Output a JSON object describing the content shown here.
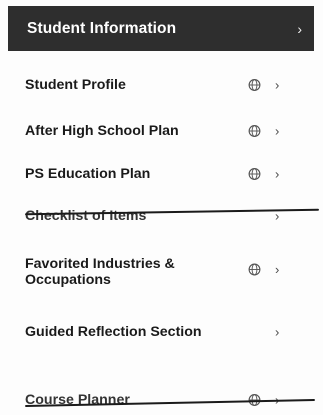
{
  "menu": {
    "header": {
      "title": "Student Information",
      "chevron": "›"
    },
    "items": [
      {
        "label": "Student Profile",
        "icon": "globe-icon",
        "chevron": "›",
        "struck": false
      },
      {
        "label": "After High School Plan",
        "icon": "globe-icon",
        "chevron": "›",
        "struck": false
      },
      {
        "label": "PS Education Plan",
        "icon": "globe-icon",
        "chevron": "›",
        "struck": false
      },
      {
        "label": "Checklist of Items",
        "icon": "",
        "chevron": "›",
        "struck": true
      },
      {
        "label": "Favorited Industries & Occupations",
        "icon": "globe-icon",
        "chevron": "›",
        "struck": false
      },
      {
        "label": "Guided Reflection Section",
        "icon": "",
        "chevron": "›",
        "struck": false
      },
      {
        "label": "Course Planner",
        "icon": "globe-icon",
        "chevron": "›",
        "struck": true
      }
    ]
  },
  "colors": {
    "header_bg": "#2e2e2e",
    "header_text": "#ffffff",
    "item_text": "#1a1a1a"
  }
}
